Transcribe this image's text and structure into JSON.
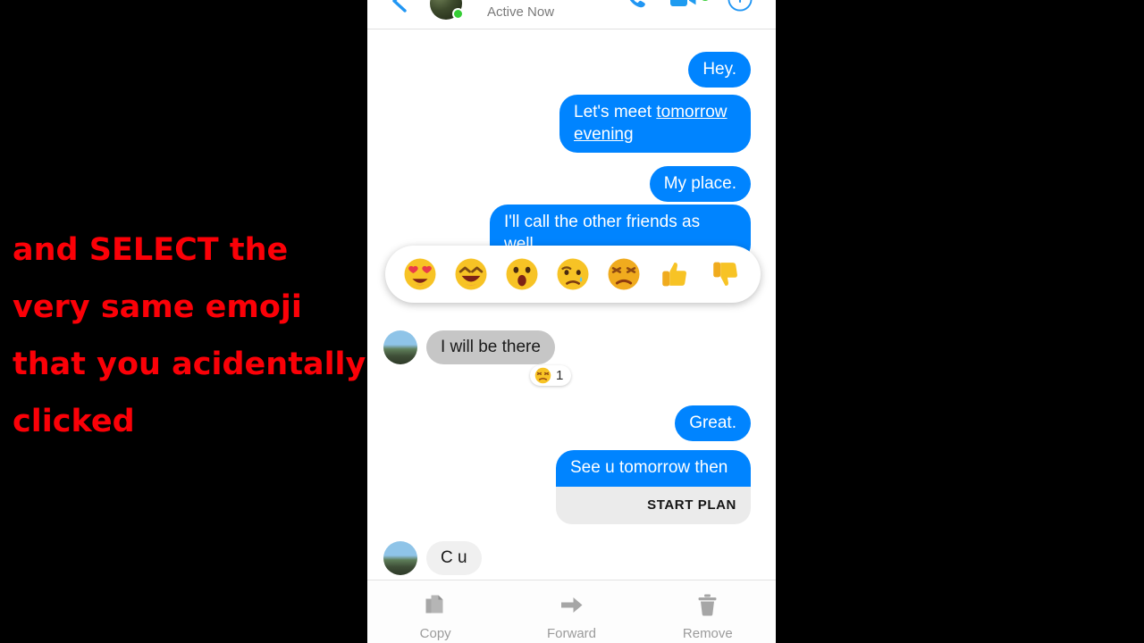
{
  "annotation": {
    "text": "and SELECT the very same emoji that you acidentally clicked",
    "color": "#fb0007"
  },
  "header": {
    "status": "Active Now",
    "back_icon": "back-arrow-icon",
    "avatar_icon": "contact-avatar",
    "presence_icon": "active-green-dot",
    "call_icon": "phone-call-icon",
    "video_icon": "video-call-icon",
    "info_icon": "info-circle-icon",
    "accent": "#0084ff"
  },
  "thread": {
    "messages": [
      {
        "id": "m1",
        "side": "out",
        "text": "Hey."
      },
      {
        "id": "m2",
        "side": "out",
        "text_before": "Let's meet ",
        "link": "tomorrow evening",
        "text_after": ""
      },
      {
        "id": "m3",
        "side": "out",
        "text": "My place."
      },
      {
        "id": "m4",
        "side": "out",
        "text": "I'll call the other friends as well."
      },
      {
        "id": "m5",
        "side": "in",
        "text": "I will be there",
        "reaction": {
          "emoji": "angry-emoji",
          "count": "1"
        }
      },
      {
        "id": "m6",
        "side": "out",
        "text": "Great."
      },
      {
        "id": "m7",
        "side": "out",
        "text": "See u tomorrow then",
        "attachment": {
          "label": "START PLAN"
        }
      },
      {
        "id": "m8",
        "side": "in",
        "text": "C u"
      }
    ],
    "bubble_out_color": "#0084ff",
    "bubble_in_color": "#c6c6c6"
  },
  "reaction_picker": {
    "emojis": [
      {
        "name": "heart-eyes-emoji",
        "label": "Love"
      },
      {
        "name": "laughing-emoji",
        "label": "Haha"
      },
      {
        "name": "wow-emoji",
        "label": "Wow"
      },
      {
        "name": "sad-emoji",
        "label": "Sad"
      },
      {
        "name": "angry-emoji",
        "label": "Angry"
      },
      {
        "name": "thumbs-up-emoji",
        "label": "Yes"
      },
      {
        "name": "thumbs-down-emoji",
        "label": "No"
      }
    ]
  },
  "action_bar": {
    "items": [
      {
        "name": "copy-action",
        "label": "Copy",
        "icon": "copy-icon"
      },
      {
        "name": "forward-action",
        "label": "Forward",
        "icon": "forward-arrow-icon"
      },
      {
        "name": "remove-action",
        "label": "Remove",
        "icon": "trash-icon"
      }
    ]
  }
}
